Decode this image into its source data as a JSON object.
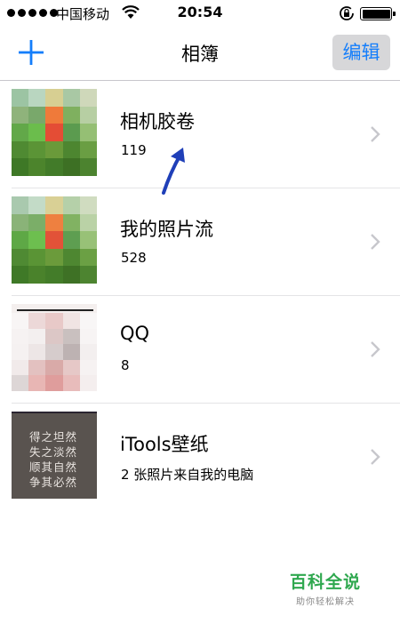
{
  "status_bar": {
    "carrier": "中国移动",
    "time": "20:54",
    "signal_icon": "signal-dots-icon",
    "wifi_icon": "wifi-icon",
    "lock_icon": "rotation-lock-icon",
    "battery_icon": "battery-icon",
    "battery_level": 1.0
  },
  "nav": {
    "add_icon": "plus-icon",
    "title": "相簿",
    "edit_label": "编辑",
    "accent_color": "#147efb"
  },
  "albums": [
    {
      "title": "相机胶卷",
      "count": "119",
      "thumbnail": "pixelated-photo-grass"
    },
    {
      "title": "我的照片流",
      "count": "528",
      "thumbnail": "pixelated-photo-grass"
    },
    {
      "title": "QQ",
      "count": "8",
      "thumbnail": "pixelated-photo-pink"
    },
    {
      "title": "iTools壁纸",
      "count": "2 张照片来自我的电脑",
      "thumbnail": "calligraphy-poster",
      "poster_lines": [
        "得之坦然",
        "失之淡然",
        "顺其自然",
        "争其必然"
      ]
    }
  ],
  "annotation": {
    "icon": "blue-arrow-icon"
  },
  "watermark": {
    "brand": "百科全说",
    "tagline": "助你轻松解决"
  }
}
